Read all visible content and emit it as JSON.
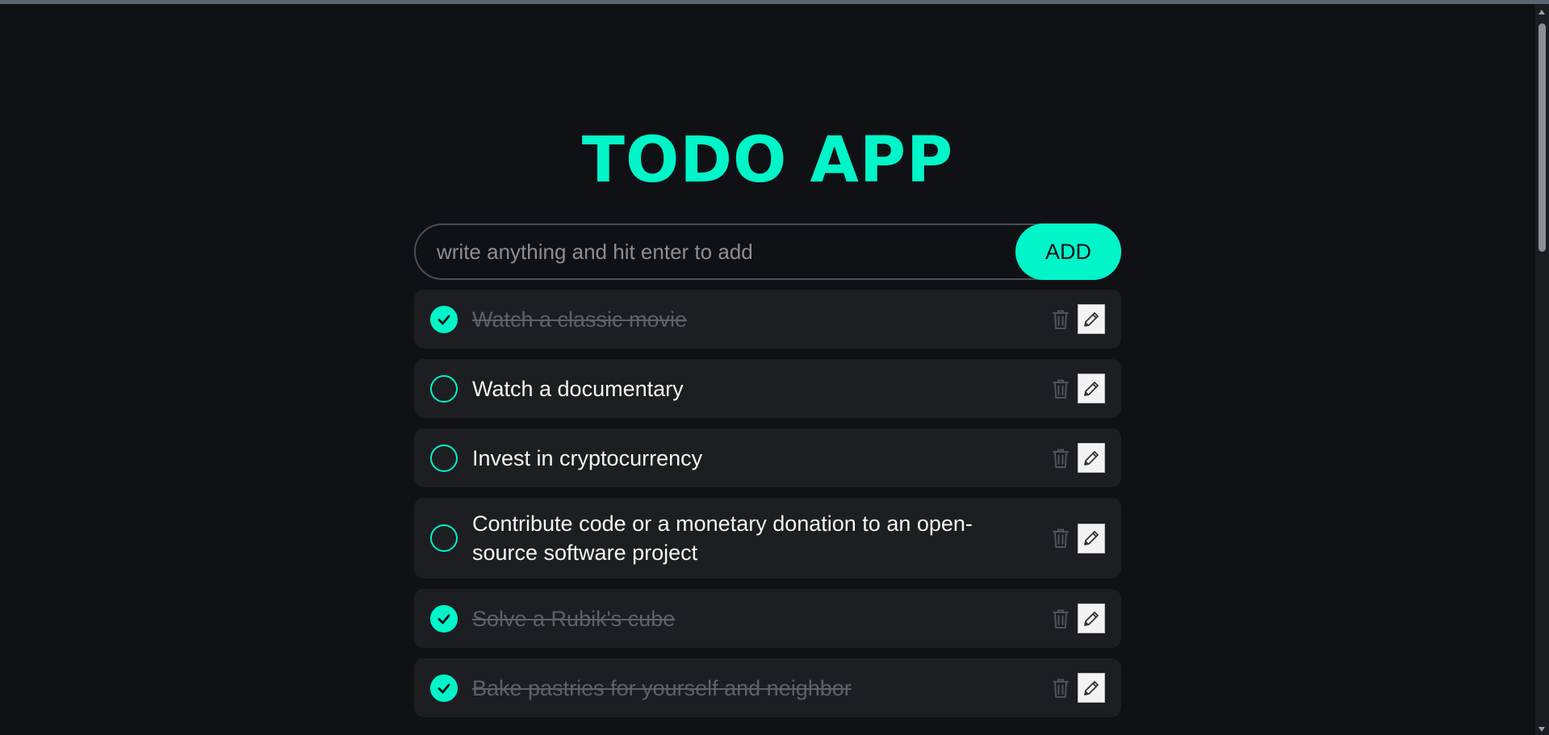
{
  "app": {
    "title": "TODO APP"
  },
  "input": {
    "placeholder": "write anything and hit enter to add",
    "value": "",
    "add_label": "ADD"
  },
  "todos": [
    {
      "text": "Watch a classic movie",
      "completed": true
    },
    {
      "text": "Watch a documentary",
      "completed": false
    },
    {
      "text": "Invest in cryptocurrency",
      "completed": false
    },
    {
      "text": "Contribute code or a monetary donation to an open-source software project",
      "completed": false
    },
    {
      "text": "Solve a Rubik's cube",
      "completed": true
    },
    {
      "text": "Bake pastries for yourself and neighbor",
      "completed": true
    }
  ],
  "icons": {
    "check": "check-icon",
    "delete": "trash-icon",
    "edit": "pencil-icon"
  },
  "colors": {
    "accent": "#00f5c8",
    "background": "#0f1115",
    "card": "#1c1e22",
    "completed_text": "#5d6168"
  }
}
